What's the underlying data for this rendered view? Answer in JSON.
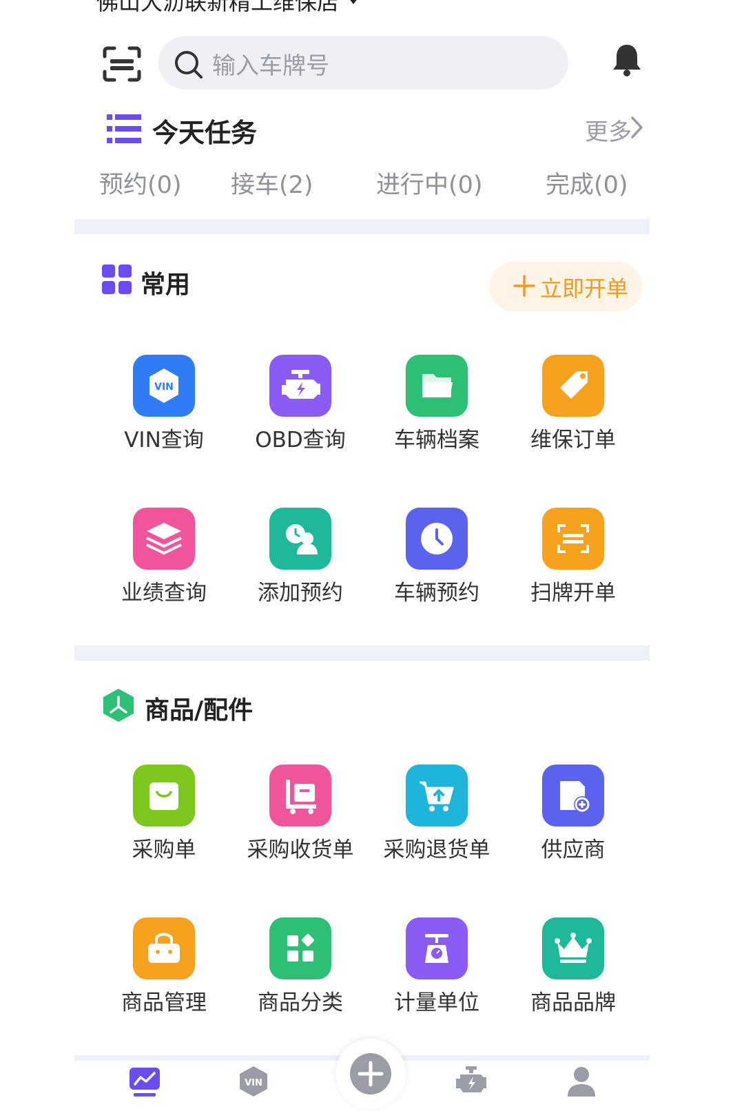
{
  "header": {
    "store_name": "佛山大沥联新精工维保店",
    "search_placeholder": "输入车牌号"
  },
  "tasks": {
    "title": "今天任务",
    "more_label": "更多",
    "tabs": [
      "预约(0)",
      "接车(2)",
      "进行中(0)",
      "完成(0)"
    ]
  },
  "common": {
    "title": "常用",
    "open_order_label": "立即开单",
    "items": [
      {
        "label": "VIN查询",
        "icon": "vin-icon",
        "color": "#2f7cf6"
      },
      {
        "label": "OBD查询",
        "icon": "engine-icon",
        "color": "#8a5cf5"
      },
      {
        "label": "车辆档案",
        "icon": "folder-icon",
        "color": "#2dbf73"
      },
      {
        "label": "维保订单",
        "icon": "tag-icon",
        "color": "#f7a21e"
      },
      {
        "label": "业绩查询",
        "icon": "layers-icon",
        "color": "#f0559b"
      },
      {
        "label": "添加预约",
        "icon": "add-appointment-icon",
        "color": "#1fb898"
      },
      {
        "label": "车辆预约",
        "icon": "clock-icon",
        "color": "#5b63ee"
      },
      {
        "label": "扫牌开单",
        "icon": "scan-plate-icon",
        "color": "#f7a21e"
      }
    ]
  },
  "goods": {
    "title": "商品/配件",
    "items": [
      {
        "label": "采购单",
        "icon": "shopping-bag-icon",
        "color": "#7cc61e"
      },
      {
        "label": "采购收货单",
        "icon": "cart-receive-icon",
        "color": "#f0559b"
      },
      {
        "label": "采购退货单",
        "icon": "cart-return-icon",
        "color": "#1fb4d9"
      },
      {
        "label": "供应商",
        "icon": "supplier-icon",
        "color": "#5b63ee"
      },
      {
        "label": "商品管理",
        "icon": "basket-icon",
        "color": "#f7a21e"
      },
      {
        "label": "商品分类",
        "icon": "category-icon",
        "color": "#2dbf73"
      },
      {
        "label": "计量单位",
        "icon": "scale-icon",
        "color": "#8a5cf5"
      },
      {
        "label": "商品品牌",
        "icon": "crown-icon",
        "color": "#1fb898"
      }
    ]
  },
  "tabbar": {
    "items": [
      "dashboard-icon",
      "vin-tab-icon",
      "add-icon",
      "engine-tab-icon",
      "profile-icon"
    ],
    "active_color": "#6a4cf0"
  }
}
